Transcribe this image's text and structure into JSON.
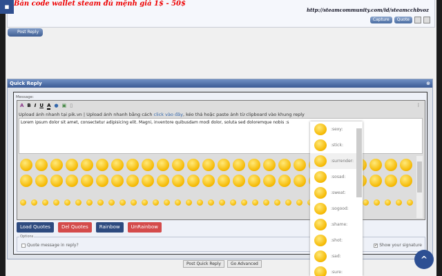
{
  "post": {
    "title": "Bán code wallet steam đủ mệnh giá 1$ - 50$",
    "signature": "http://steamcommunity.com/id/steamcchbvoz",
    "capture": "Capture",
    "quote": "Quote"
  },
  "post_reply": "Post Reply",
  "quick_reply": {
    "title": "Quick Reply",
    "message_label": "Message:",
    "toolbar": {
      "bold": "B",
      "italic": "I",
      "underline": "U",
      "font_color": "A"
    },
    "upload_link": "Upload ảnh nhanh tại pik.vn",
    "upload_hint_pre": "Upload ảnh nhanh bằng cách",
    "upload_hint_link": "click vào đây",
    "upload_hint_post": ", kéo thả hoặc paste ảnh từ clipboard vào khung reply",
    "message_value": "Lorem ipsum dolor sit amet, consectetur adipisicing elit. Magni, inventore quibusdam modi dolor, soluta sed doloremque nobis :s",
    "buttons": [
      "Load Quotes",
      "Del Quotes",
      "Rainbow",
      "UnRainbow"
    ],
    "options_legend": "Options",
    "quote_option": "Quote message in reply?",
    "signature_option": "Show your signature",
    "signature_checked": true,
    "quote_checked": false,
    "post_quick_reply": "Post Quick Reply",
    "go_advanced": "Go Advanced"
  },
  "smiley_dropdown": [
    ":sexy:",
    ":stick:",
    ":surrender:",
    ":sosad:",
    ":sweat:",
    ":sogood:",
    ":shame:",
    ":shot:",
    ":sad:",
    ":sure:"
  ],
  "colors": {
    "header": "#3b5b95",
    "load": "#2d4a7f",
    "del": "#d44b4b",
    "scroll_top": "#2d4f93",
    "title": "#e00000"
  }
}
